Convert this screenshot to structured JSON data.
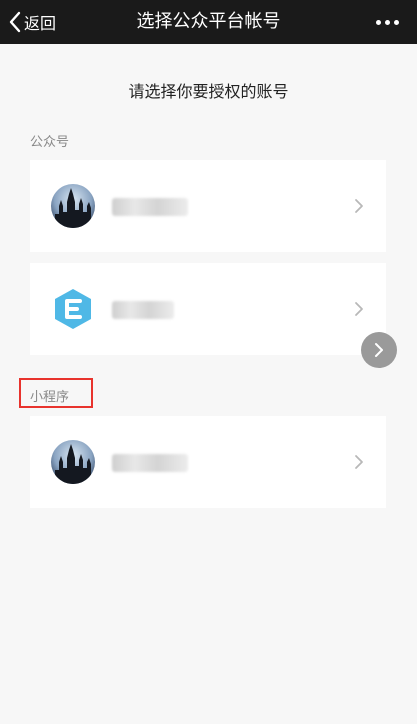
{
  "nav": {
    "back_label": "返回",
    "title": "选择公众平台帐号",
    "more_icon": "more-dots-icon"
  },
  "prompt": "请选择你要授权的账号",
  "sections": {
    "official_accounts": {
      "label": "公众号",
      "items": [
        {
          "avatar": "castle-avatar",
          "name_blurred": true
        },
        {
          "avatar": "e-logo-avatar",
          "name_blurred": true
        }
      ]
    },
    "mini_programs": {
      "label": "小程序",
      "highlighted": true,
      "items": [
        {
          "avatar": "castle-avatar",
          "name_blurred": true
        }
      ]
    }
  },
  "colors": {
    "navbar": "#1a1a1a",
    "background": "#f7f7f7",
    "highlight": "#e8332d",
    "logo_blue": "#4fb8e6"
  }
}
